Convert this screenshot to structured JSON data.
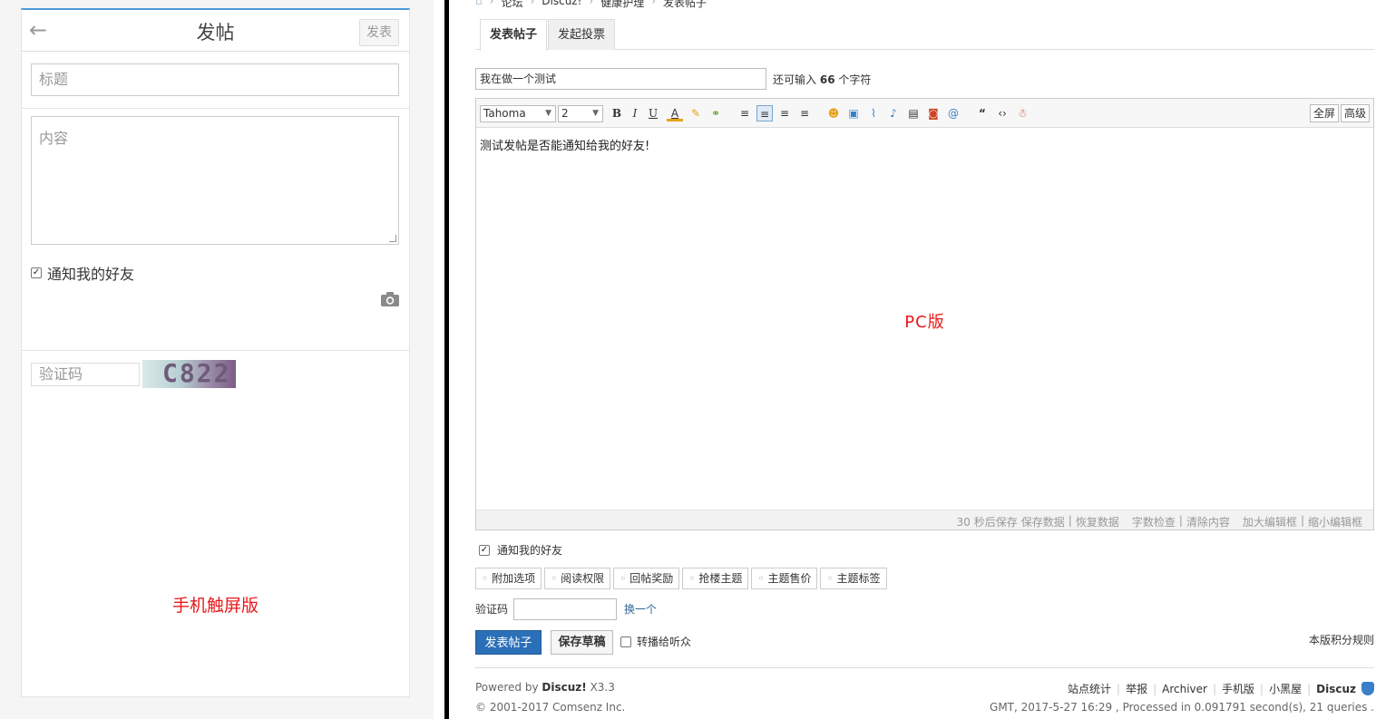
{
  "mobile": {
    "header": {
      "back": "←",
      "title": "发帖",
      "post_button": "发表"
    },
    "title_placeholder": "标题",
    "content_placeholder": "内容",
    "notify_label": "通知我的好友",
    "captcha_placeholder": "验证码",
    "captcha_text": "C822",
    "edition_label": "手机触屏版"
  },
  "pc": {
    "breadcrumb": [
      "论坛",
      "Discuz!",
      "健康护理",
      "发表帖子"
    ],
    "tabs": [
      {
        "label": "发表帖子",
        "active": true
      },
      {
        "label": "发起投票",
        "active": false
      }
    ],
    "subject_value": "我在做一个测试",
    "remain_prefix": "还可输入",
    "remain_count": "66",
    "remain_suffix": "个字符",
    "toolbar": {
      "font_family": "Tahoma",
      "font_size": "2",
      "right_buttons": [
        "全屏",
        "高级"
      ]
    },
    "body_text": "测试发帖是否能通知给我的好友!",
    "edition_label": "PC版",
    "status_links": [
      "30 秒后保存",
      "保存数据",
      "|",
      "恢复数据",
      "字数检查",
      "|",
      "清除内容",
      "加大编辑框",
      "|",
      "缩小编辑框"
    ],
    "notify_label": "通知我的好友",
    "options": [
      "附加选项",
      "阅读权限",
      "回帖奖励",
      "抢楼主题",
      "主题售价",
      "主题标签"
    ],
    "captcha_label": "验证码",
    "captcha_change": "换一个",
    "submit_label": "发表帖子",
    "draft_label": "保存草稿",
    "forward_label": "转播给听众",
    "rules_link": "本版积分规则",
    "footer": {
      "powered_prefix": "Powered by",
      "powered_brand": "Discuz!",
      "powered_version": "X3.3",
      "copyright": "© 2001-2017 Comsenz Inc.",
      "links": [
        "站点统计",
        "举报",
        "Archiver",
        "手机版",
        "小黑屋",
        "Discuz"
      ],
      "gmt": "GMT, 2017-5-27 16:29 , Processed in 0.091791 second(s), 21 queries ."
    },
    "colors": {
      "accent": "#2a6fb8",
      "label_red": "#e8191b"
    }
  }
}
